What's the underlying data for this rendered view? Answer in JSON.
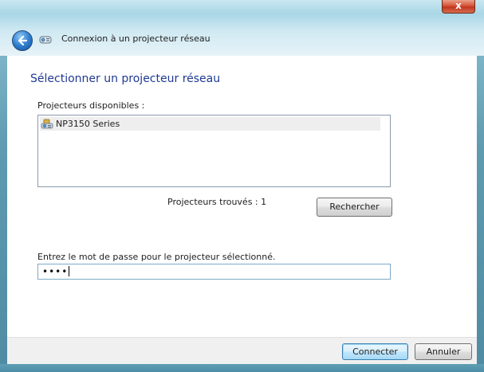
{
  "window": {
    "title": "Connexion à un projecteur réseau",
    "close_glyph": "x"
  },
  "page": {
    "heading": "Sélectionner un projecteur réseau",
    "available_label": "Projecteurs disponibles :",
    "projectors": [
      {
        "name": "NP3150 Series",
        "icon": "network-projector-icon",
        "selected": true
      }
    ],
    "found_text": "Projecteurs trouvés : 1",
    "search_button": "Rechercher",
    "password_label": "Entrez le mot de passe pour le projecteur sélectionné.",
    "password_value": "••••"
  },
  "footer": {
    "connect_button": "Connecter",
    "cancel_button": "Annuler"
  },
  "colors": {
    "heading": "#1f3a93",
    "frame": "#5d9db2",
    "close": "#c0361f"
  }
}
